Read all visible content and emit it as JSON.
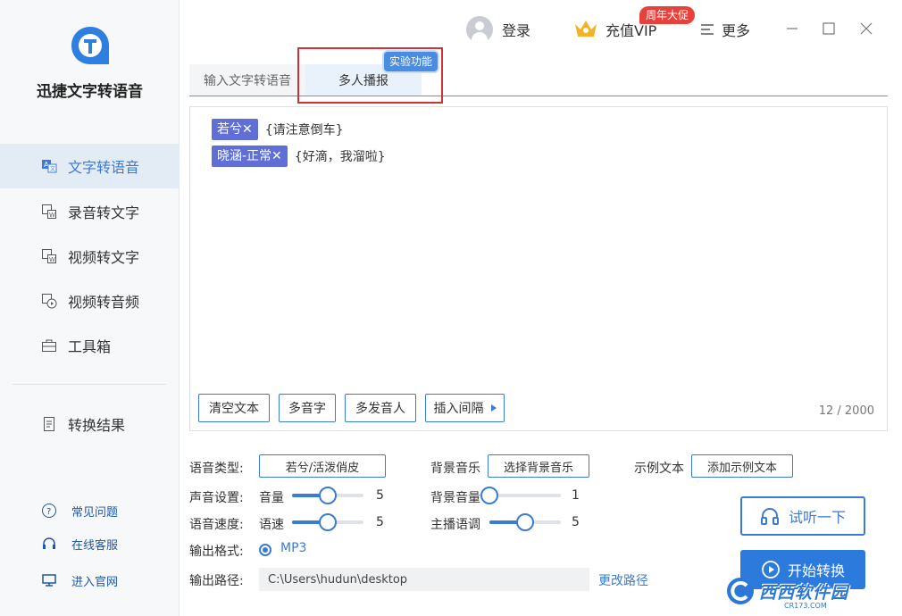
{
  "app": {
    "title": "迅捷文字转语音"
  },
  "sidebar": {
    "items": [
      {
        "label": "文字转语音",
        "icon": "text-to-speech-icon"
      },
      {
        "label": "录音转文字",
        "icon": "recording-to-text-icon"
      },
      {
        "label": "视频转文字",
        "icon": "video-to-text-icon"
      },
      {
        "label": "视频转音频",
        "icon": "video-to-audio-icon"
      },
      {
        "label": "工具箱",
        "icon": "toolbox-icon"
      }
    ],
    "result": {
      "label": "转换结果",
      "icon": "result-icon"
    },
    "footer": [
      {
        "label": "常见问题",
        "icon": "question-icon"
      },
      {
        "label": "在线客服",
        "icon": "headset-icon"
      },
      {
        "label": "进入官网",
        "icon": "monitor-icon"
      }
    ]
  },
  "topbar": {
    "login_label": "登录",
    "vip_label": "充值VIP",
    "promo_badge": "周年大促",
    "more_label": "更多"
  },
  "tabs": [
    {
      "label": "输入文字转语音",
      "active": false
    },
    {
      "label": "多人播报",
      "active": true
    }
  ],
  "experimental_badge": "实验功能",
  "editor": {
    "lines": [
      {
        "speaker": "若兮✕",
        "text": "{请注意倒车}"
      },
      {
        "speaker": "晓涵-正常✕",
        "text": "{好滴，我溜啦}"
      }
    ],
    "buttons": {
      "clear": "清空文本",
      "polyphone": "多音字",
      "multi_speaker": "多发音人",
      "insert_pause": "插入间隔"
    },
    "char_count": "12 / 2000"
  },
  "settings": {
    "voice_type_label": "语音类型:",
    "voice_type_value": "若兮/活泼俏皮",
    "bgm_label": "背景音乐",
    "bgm_button": "选择背景音乐",
    "sample_label": "示例文本",
    "sample_button": "添加示例文本",
    "sound_label": "声音设置:",
    "volume_label": "音量",
    "volume_value": "5",
    "volume_fraction": 0.5,
    "bg_volume_label": "背景音量",
    "bg_volume_value": "1",
    "bg_volume_fraction": 0.0,
    "speed_section_label": "语音速度:",
    "speed_label": "语速",
    "speed_value": "5",
    "speed_fraction": 0.5,
    "pitch_label": "主播语调",
    "pitch_value": "5",
    "pitch_fraction": 0.5,
    "format_label": "输出格式:",
    "format_value": "MP3",
    "path_label": "输出路径:",
    "path_value": "C:\\Users\\hudun\\desktop",
    "change_path": "更改路径"
  },
  "actions": {
    "preview": "试听一下",
    "start": "开始转换"
  },
  "watermark": {
    "text": "西西软件园",
    "sub": "CR173.COM"
  },
  "colors": {
    "accent": "#3a7bd5",
    "speaker_tag": "#5f6fd6",
    "promo": "#e8403a",
    "highlight": "#d0323a"
  }
}
